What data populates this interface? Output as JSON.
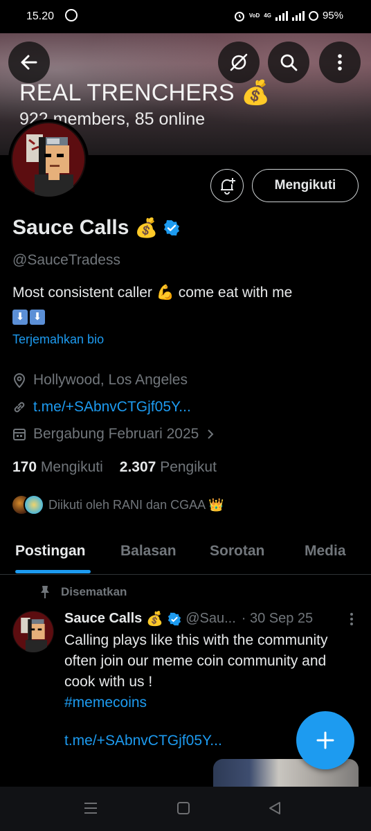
{
  "status_bar": {
    "time": "15.20",
    "carrier": "VoD",
    "network": "4G",
    "battery": "95%"
  },
  "header": {
    "community_title": "REAL TRENCHERS",
    "community_emoji": "💰",
    "community_subtitle": "922 members, 85 online",
    "back_icon": "arrow-left-icon",
    "grok_icon": "grok-icon",
    "search_icon": "search-icon",
    "more_icon": "more-vertical-icon"
  },
  "profile": {
    "name": "Sauce Calls",
    "name_emoji": "💰",
    "handle": "@SauceTradess",
    "bio_line1": "Most consistent caller 💪 come eat with me",
    "bio_arrows": [
      "⬇",
      "⬇"
    ],
    "translate_label": "Terjemahkan bio",
    "location": "Hollywood, Los Angeles",
    "link": "t.me/+SAbnvCTGjf05Y...",
    "joined": "Bergabung Februari 2025",
    "following_count": "170",
    "following_label": "Mengikuti",
    "followers_count": "2.307",
    "followers_label": "Pengikut",
    "followed_by": "Diikuti oleh RANI dan CGAA 👑",
    "follow_button": "Mengikuti"
  },
  "tabs": [
    {
      "label": "Postingan",
      "active": true
    },
    {
      "label": "Balasan",
      "active": false
    },
    {
      "label": "Sorotan",
      "active": false
    },
    {
      "label": "Media",
      "active": false
    }
  ],
  "post": {
    "pinned_label": "Disematkan",
    "author": "Sauce Calls",
    "author_emoji": "💰",
    "handle": "@Sau...",
    "date": "· 30 Sep 25",
    "body": "Calling plays like this with the community often join our meme coin community and cook with us !",
    "hashtag": "#memecoins",
    "link": "t.me/+SAbnvCTGjf05Y..."
  },
  "colors": {
    "accent": "#1d9bf0",
    "text": "#e7e9ea",
    "muted": "#71767b",
    "background": "#000000"
  }
}
